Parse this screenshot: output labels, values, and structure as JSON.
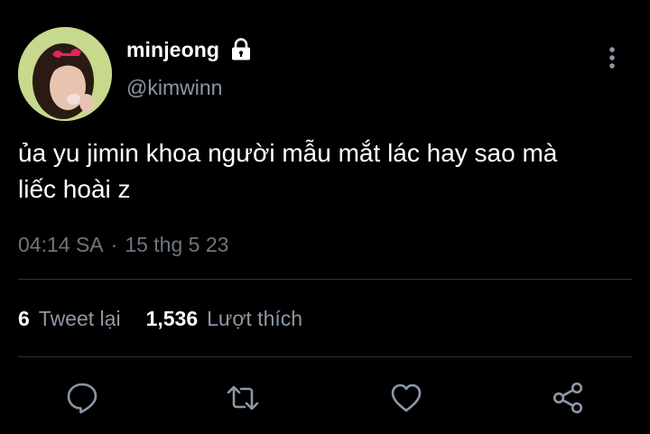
{
  "tweet": {
    "display_name": "minjeong",
    "handle": "@kimwinn",
    "text_line1": "ủa yu jimin khoa người mẫu mắt lác hay sao mà",
    "text_line2": "liếc hoài z",
    "time": "04:14 SA",
    "separator": "·",
    "date": "15 thg 5 23",
    "retweet_count": "6",
    "retweet_label": "Tweet lại",
    "like_count": "1,536",
    "like_label": "Lượt thích"
  },
  "icons": {
    "lock": "lock-icon",
    "more": "more-vertical-icon",
    "reply": "reply-icon",
    "retweet": "retweet-icon",
    "like": "heart-icon",
    "share": "share-icon"
  },
  "colors": {
    "background": "#000000",
    "primary_text": "#ffffff",
    "secondary_text": "#8b98a5",
    "divider": "#2f3336",
    "icon": "#8b98a5"
  }
}
